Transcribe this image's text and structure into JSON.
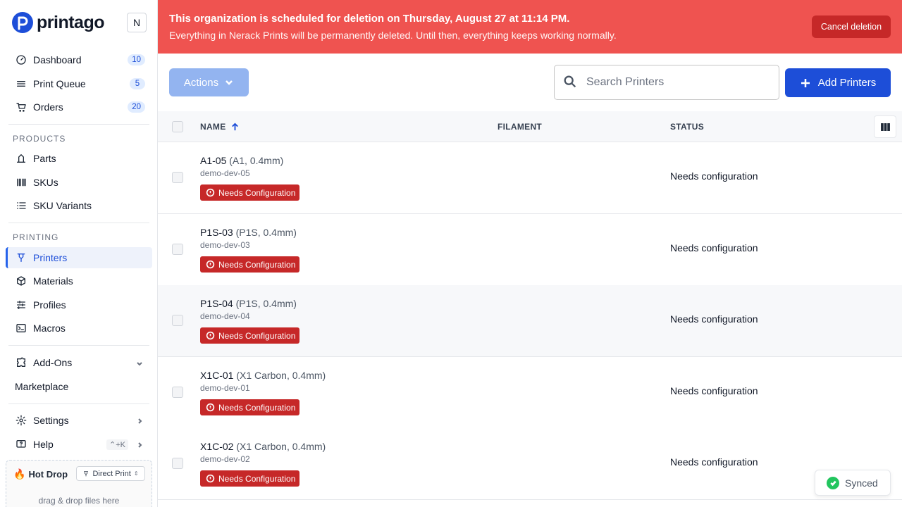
{
  "brand": {
    "name": "printago",
    "org_initial": "N"
  },
  "sidebar": {
    "main": [
      {
        "label": "Dashboard",
        "badge": "10"
      },
      {
        "label": "Print Queue",
        "badge": "5"
      },
      {
        "label": "Orders",
        "badge": "20"
      }
    ],
    "products_label": "PRODUCTS",
    "products": [
      {
        "label": "Parts"
      },
      {
        "label": "SKUs"
      },
      {
        "label": "SKU Variants"
      }
    ],
    "printing_label": "PRINTING",
    "printing": [
      {
        "label": "Printers"
      },
      {
        "label": "Materials"
      },
      {
        "label": "Profiles"
      },
      {
        "label": "Macros"
      }
    ],
    "addons": "Add-Ons",
    "marketplace": "Marketplace",
    "settings": "Settings",
    "help": "Help",
    "help_shortcut": "⌃+K",
    "hotdrop": {
      "title": "Hot Drop",
      "mode": "Direct Print",
      "hint": "drag & drop files here"
    }
  },
  "banner": {
    "title": "This organization is scheduled for deletion on Thursday, August 27 at 11:14 PM.",
    "subtitle": "Everything in Nerack Prints will be permanently deleted. Until then, everything keeps working normally.",
    "cancel_label": "Cancel deletion",
    "color": "#ef5350"
  },
  "toolbar": {
    "actions_label": "Actions",
    "search_placeholder": "Search Printers",
    "add_label": "Add Printers"
  },
  "table": {
    "columns": {
      "name": "NAME",
      "filament": "FILAMENT",
      "status": "STATUS"
    },
    "rows": [
      {
        "name": "A1-05",
        "spec": "(A1, 0.4mm)",
        "id": "demo-dev-05",
        "badge": "Needs Configuration",
        "status": "Needs configuration"
      },
      {
        "name": "P1S-03",
        "spec": "(P1S, 0.4mm)",
        "id": "demo-dev-03",
        "badge": "Needs Configuration",
        "status": "Needs configuration"
      },
      {
        "name": "P1S-04",
        "spec": "(P1S, 0.4mm)",
        "id": "demo-dev-04",
        "badge": "Needs Configuration",
        "status": "Needs configuration"
      },
      {
        "name": "X1C-01",
        "spec": "(X1 Carbon, 0.4mm)",
        "id": "demo-dev-01",
        "badge": "Needs Configuration",
        "status": "Needs configuration"
      },
      {
        "name": "X1C-02",
        "spec": "(X1 Carbon, 0.4mm)",
        "id": "demo-dev-02",
        "badge": "Needs Configuration",
        "status": "Needs configuration"
      }
    ]
  },
  "toast": {
    "label": "Synced"
  },
  "colors": {
    "primary": "#1d4ed8",
    "danger": "#c62828",
    "success": "#22c55e"
  }
}
